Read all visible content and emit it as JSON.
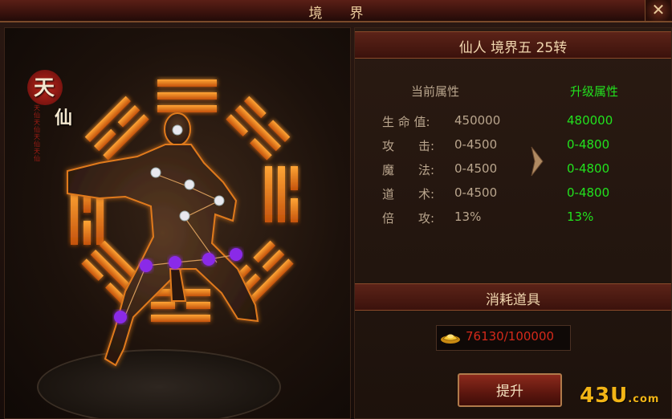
{
  "window": {
    "title": "境界",
    "close_glyph": "✕"
  },
  "emblem": {
    "char_top": "天",
    "char_bottom": "仙",
    "seal_text": "天仙天仙天仙天仙"
  },
  "realm": {
    "heading": "仙人 境界五 25转"
  },
  "attributes": {
    "current_header": "当前属性",
    "upgrade_header": "升级属性",
    "rows": [
      {
        "label": "生 命 值:",
        "current": "450000",
        "upgrade": "480000"
      },
      {
        "label": "攻　　击:",
        "current": "0-4500",
        "upgrade": "0-4800"
      },
      {
        "label": "魔　　法:",
        "current": "0-4500",
        "upgrade": "0-4800"
      },
      {
        "label": "道　　术:",
        "current": "0-4500",
        "upgrade": "0-4800"
      },
      {
        "label": "倍　　攻:",
        "current": "13%",
        "upgrade": "13%"
      }
    ]
  },
  "consume": {
    "header": "消耗道具",
    "item_icon": "gold-ingot-icon",
    "amount": "76130/100000"
  },
  "upgrade_button": {
    "label": "提升"
  },
  "watermark": {
    "text": "43U",
    "suffix": ".com"
  },
  "colors": {
    "green": "#22e21e",
    "cost_red": "#d4291a",
    "orange_glow": "#ff8a1a"
  }
}
